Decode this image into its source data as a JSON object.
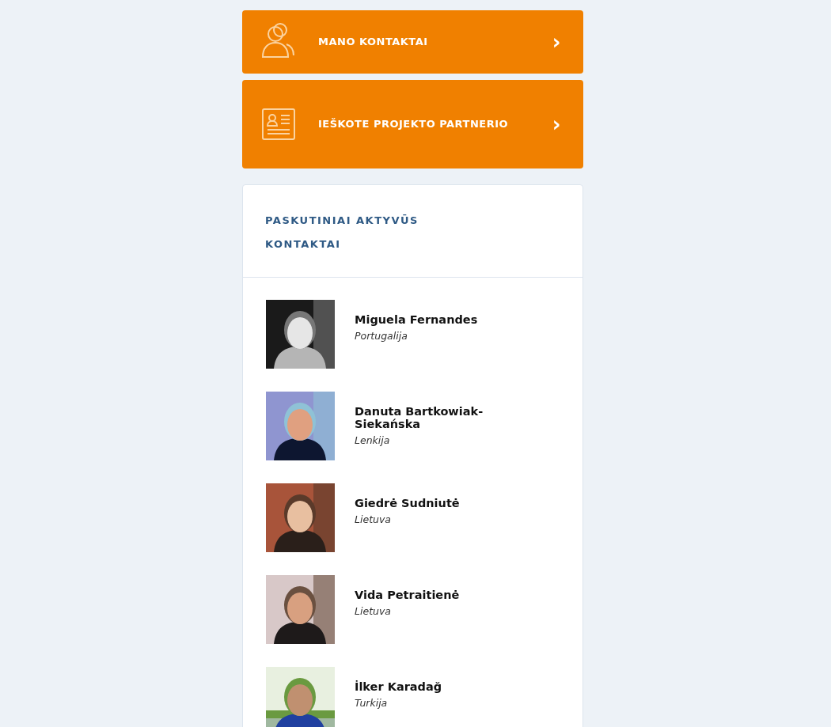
{
  "menu_buttons": [
    {
      "kind": "contacts",
      "label": "MANO KONTAKTAI",
      "chevron": "›"
    },
    {
      "kind": "card",
      "label": "IEŠKOTE PROJEKTO PARTNERIO",
      "chevron": "›"
    }
  ],
  "recent_contacts": {
    "title": "PASKUTINIAI AKTYVŪS KONTAKTAI",
    "contacts": [
      {
        "name": "Miguela Fernandes",
        "country": "Portugalija"
      },
      {
        "name": "Danuta Bartkowiak-Siekańska",
        "country": "Lenkija"
      },
      {
        "name": "Giedrė Sudniutė",
        "country": "Lietuva"
      },
      {
        "name": "Vida Petraitienė",
        "country": "Lietuva"
      },
      {
        "name": "İlker Karadağ",
        "country": "Turkija"
      }
    ]
  }
}
